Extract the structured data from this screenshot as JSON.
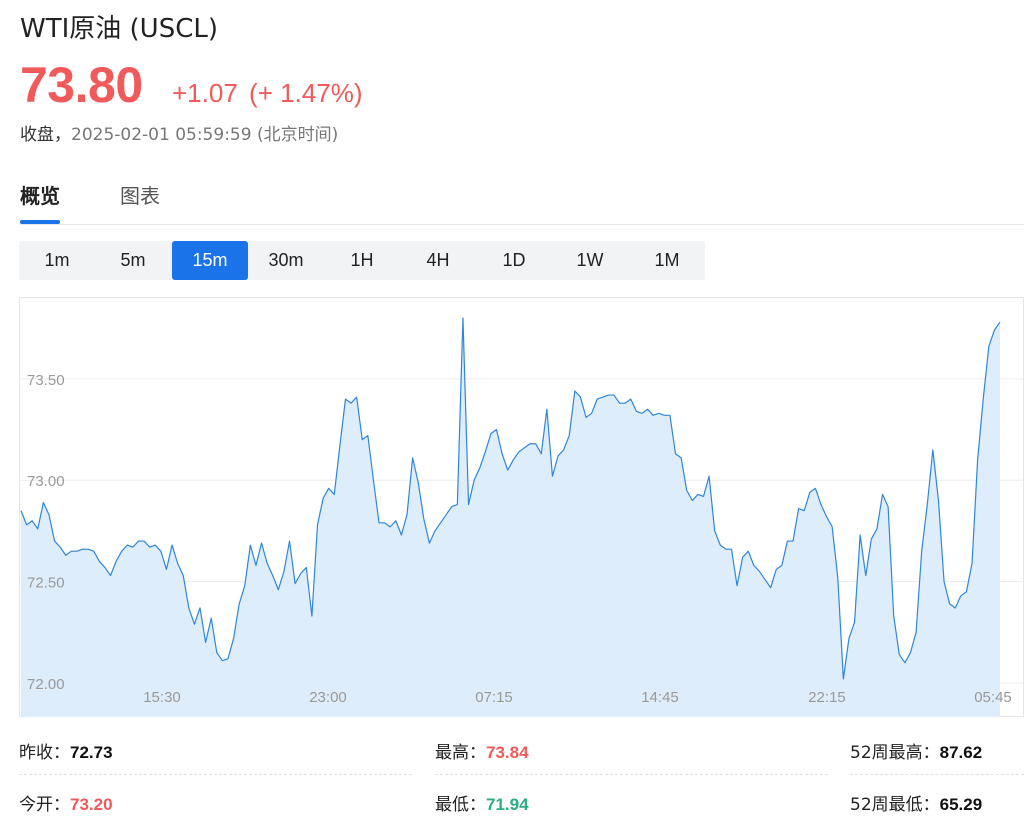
{
  "header": {
    "title": "WTI原油 (USCL)",
    "price": "73.80",
    "change": "+1.07",
    "change_pct": "(+ 1.47%)",
    "status_label": "收盘，",
    "timestamp": "2025-02-01 05:59:59 (北京时间)"
  },
  "tabs": [
    {
      "label": "概览",
      "active": true
    },
    {
      "label": "图表",
      "active": false
    }
  ],
  "intervals": [
    "1m",
    "5m",
    "15m",
    "30m",
    "1H",
    "4H",
    "1D",
    "1W",
    "1M"
  ],
  "selected_interval": "15m",
  "colors": {
    "up": "#f05a5a",
    "down": "#2aae84",
    "accent": "#1a73e8",
    "area": "#deedfc",
    "line": "#2f86d8"
  },
  "chart_data": {
    "type": "area",
    "ylim": [
      71.92,
      73.84
    ],
    "yticks": [
      "72.00",
      "72.50",
      "73.00",
      "73.50"
    ],
    "xticks": [
      "15:30",
      "23:00",
      "07:15",
      "14:45",
      "22:15",
      "05:45"
    ],
    "grid": true,
    "values": [
      72.85,
      72.78,
      72.8,
      72.76,
      72.89,
      72.83,
      72.7,
      72.67,
      72.63,
      72.65,
      72.65,
      72.66,
      72.66,
      72.65,
      72.6,
      72.57,
      72.53,
      72.6,
      72.65,
      72.68,
      72.67,
      72.7,
      72.7,
      72.67,
      72.68,
      72.65,
      72.56,
      72.68,
      72.59,
      72.53,
      72.37,
      72.29,
      72.37,
      72.2,
      72.32,
      72.15,
      72.11,
      72.12,
      72.22,
      72.39,
      72.48,
      72.68,
      72.58,
      72.69,
      72.59,
      72.53,
      72.46,
      72.55,
      72.7,
      72.49,
      72.54,
      72.57,
      72.33,
      72.78,
      72.91,
      72.96,
      72.93,
      73.17,
      73.4,
      73.38,
      73.41,
      73.2,
      73.22,
      73.0,
      72.79,
      72.79,
      72.77,
      72.8,
      72.73,
      72.83,
      73.11,
      72.99,
      72.81,
      72.69,
      72.75,
      72.79,
      72.83,
      72.87,
      72.88,
      73.8,
      72.88,
      73.0,
      73.06,
      73.14,
      73.23,
      73.25,
      73.13,
      73.05,
      73.1,
      73.14,
      73.16,
      73.18,
      73.18,
      73.13,
      73.35,
      73.02,
      73.12,
      73.15,
      73.22,
      73.44,
      73.41,
      73.31,
      73.33,
      73.4,
      73.41,
      73.42,
      73.42,
      73.38,
      73.38,
      73.4,
      73.34,
      73.33,
      73.35,
      73.32,
      73.33,
      73.32,
      73.32,
      73.13,
      73.11,
      72.95,
      72.9,
      72.93,
      72.92,
      73.02,
      72.75,
      72.68,
      72.66,
      72.66,
      72.48,
      72.62,
      72.65,
      72.58,
      72.55,
      72.51,
      72.47,
      72.56,
      72.58,
      72.7,
      72.7,
      72.86,
      72.85,
      72.94,
      72.96,
      72.88,
      72.82,
      72.77,
      72.52,
      72.02,
      72.22,
      72.3,
      72.73,
      72.53,
      72.71,
      72.76,
      72.93,
      72.87,
      72.33,
      72.14,
      72.1,
      72.15,
      72.25,
      72.65,
      72.88,
      73.15,
      72.9,
      72.5,
      72.39,
      72.37,
      72.43,
      72.45,
      72.59,
      73.1,
      73.4,
      73.66,
      73.74,
      73.78
    ]
  },
  "stats": {
    "prev_close_label": "昨收：",
    "prev_close": "72.73",
    "high_label": "最高：",
    "high": "73.84",
    "week52_high_label": "52周最高：",
    "week52_high": "87.62",
    "open_label": "今开：",
    "open": "73.20",
    "low_label": "最低：",
    "low": "71.94",
    "week52_low_label": "52周最低：",
    "week52_low": "65.29"
  }
}
